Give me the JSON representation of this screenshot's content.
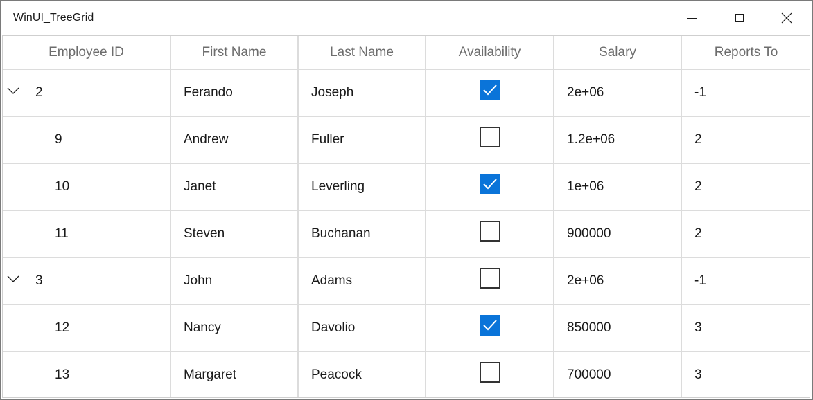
{
  "window": {
    "title": "WinUI_TreeGrid"
  },
  "columns": [
    {
      "key": "id",
      "label": "Employee ID"
    },
    {
      "key": "first",
      "label": "First Name"
    },
    {
      "key": "last",
      "label": "Last Name"
    },
    {
      "key": "avail",
      "label": "Availability"
    },
    {
      "key": "salary",
      "label": "Salary"
    },
    {
      "key": "reports",
      "label": "Reports To"
    }
  ],
  "rows": [
    {
      "id": "2",
      "first": "Ferando",
      "last": "Joseph",
      "available": true,
      "salary": "2e+06",
      "reports": "-1",
      "level": 0,
      "expanded": true
    },
    {
      "id": "9",
      "first": "Andrew",
      "last": "Fuller",
      "available": false,
      "salary": "1.2e+06",
      "reports": "2",
      "level": 1
    },
    {
      "id": "10",
      "first": "Janet",
      "last": "Leverling",
      "available": true,
      "salary": "1e+06",
      "reports": "2",
      "level": 1
    },
    {
      "id": "11",
      "first": "Steven",
      "last": "Buchanan",
      "available": false,
      "salary": "900000",
      "reports": "2",
      "level": 1
    },
    {
      "id": "3",
      "first": "John",
      "last": "Adams",
      "available": false,
      "salary": "2e+06",
      "reports": "-1",
      "level": 0,
      "expanded": true
    },
    {
      "id": "12",
      "first": "Nancy",
      "last": "Davolio",
      "available": true,
      "salary": "850000",
      "reports": "3",
      "level": 1
    },
    {
      "id": "13",
      "first": "Margaret",
      "last": "Peacock",
      "available": false,
      "salary": "700000",
      "reports": "3",
      "level": 1
    }
  ],
  "colors": {
    "accent": "#0a74d9",
    "grid_line": "#dcdcdc",
    "header_text": "#6d6d6d"
  },
  "icons": {
    "minimize": "minimize-icon",
    "maximize": "maximize-icon",
    "close": "close-icon",
    "expander": "chevron-down-icon",
    "check": "checkmark-icon"
  }
}
